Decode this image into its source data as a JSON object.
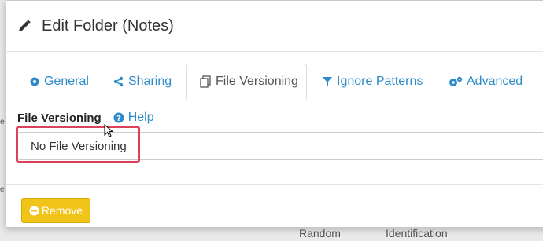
{
  "background": {
    "left_text_1": "e",
    "left_text_2": "e",
    "left_text_3": "e",
    "bottom_text_1": "Random",
    "bottom_text_2": "Identification"
  },
  "modal": {
    "title": "Edit Folder (Notes)",
    "tabs": [
      {
        "label": "General",
        "icon": "gear-icon"
      },
      {
        "label": "Sharing",
        "icon": "share-icon"
      },
      {
        "label": "File Versioning",
        "icon": "copy-icon"
      },
      {
        "label": "Ignore Patterns",
        "icon": "filter-icon"
      },
      {
        "label": "Advanced",
        "icon": "gears-icon"
      }
    ],
    "active_tab": "File Versioning",
    "field": {
      "label": "File Versioning",
      "help": "Help",
      "selected_value": "No File Versioning"
    },
    "remove_label": "Remove"
  },
  "colors": {
    "link": "#2e8bc9",
    "warning": "#f0c419",
    "highlight": "#d9435a"
  }
}
